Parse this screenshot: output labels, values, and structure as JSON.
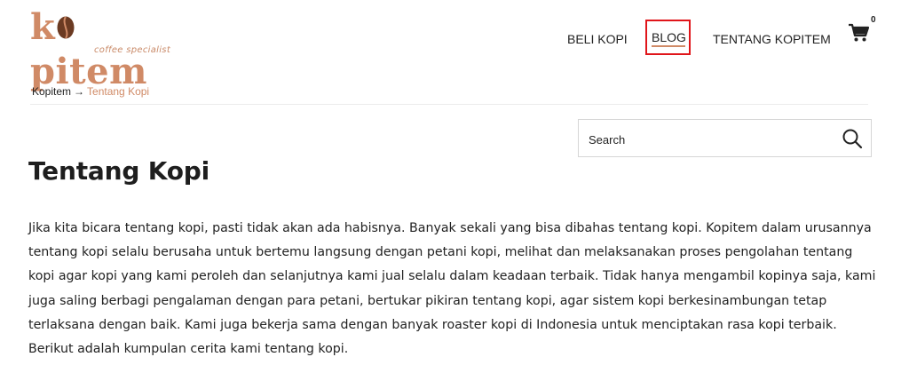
{
  "brand": {
    "logo_text": "kopitem",
    "tagline": "coffee specialist",
    "accent": "#d08a66"
  },
  "nav": {
    "items": [
      {
        "label": "BELI KOPI"
      },
      {
        "label": "BLOG"
      },
      {
        "label": "TENTANG KOPITEM"
      }
    ],
    "cart_count": "0",
    "highlight_color": "#e0151a"
  },
  "breadcrumb": {
    "home": "Kopitem",
    "separator": "→",
    "current": "Tentang Kopi"
  },
  "search": {
    "placeholder": "Search"
  },
  "content": {
    "title": "Tentang Kopi",
    "paragraph": "Jika kita bicara tentang kopi, pasti tidak akan ada habisnya. Banyak sekali yang bisa dibahas tentang kopi. Kopitem dalam urusannya tentang kopi selalu berusaha untuk bertemu langsung dengan petani kopi, melihat dan melaksanakan proses pengolahan tentang kopi agar kopi yang kami peroleh dan selanjutnya kami jual selalu dalam keadaan terbaik. Tidak hanya mengambil kopinya saja, kami juga saling berbagi pengalaman dengan para petani, bertukar pikiran tentang kopi, agar sistem kopi berkesinambungan tetap terlaksana dengan baik. Kami juga bekerja sama dengan banyak roaster kopi di Indonesia untuk menciptakan rasa kopi terbaik. Berikut adalah kumpulan cerita kami tentang kopi."
  }
}
